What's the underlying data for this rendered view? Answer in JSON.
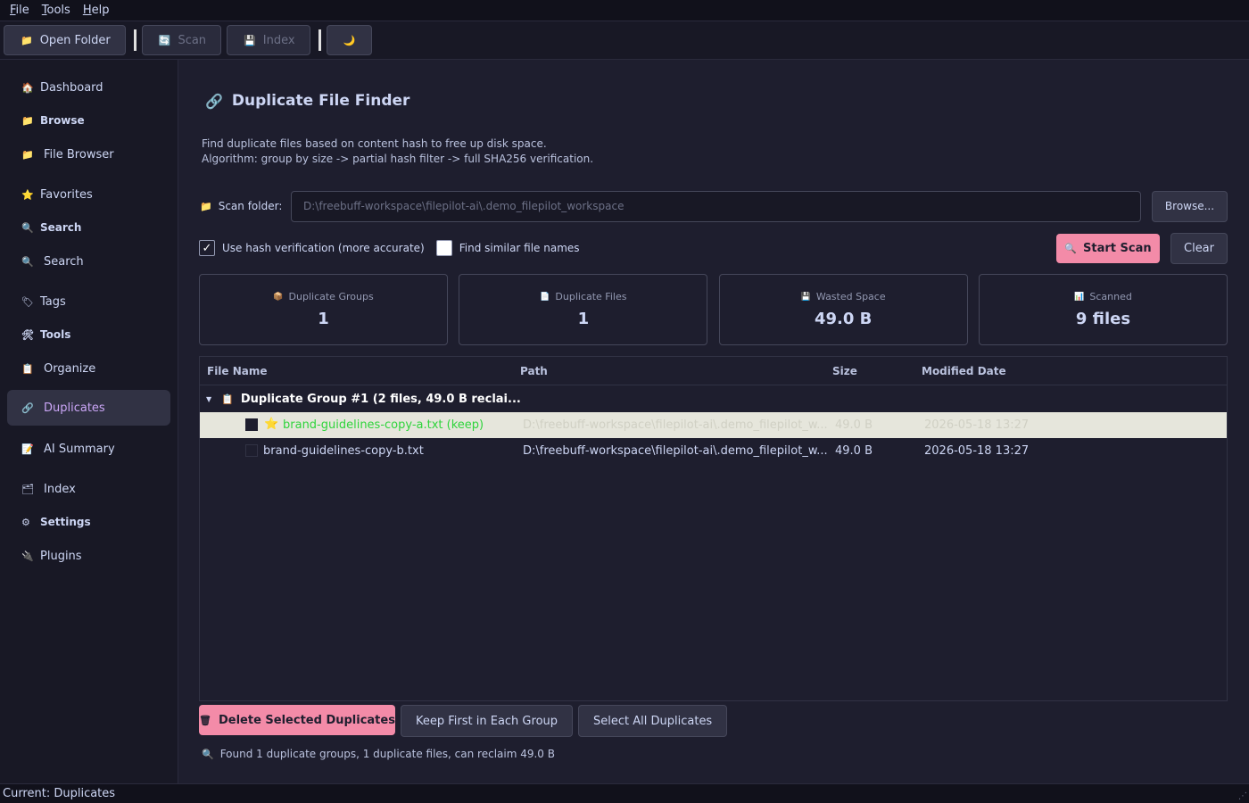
{
  "menu": [
    {
      "label": "File",
      "key": "F",
      "rest": "ile"
    },
    {
      "label": "Tools",
      "key": "T",
      "rest": "ools"
    },
    {
      "label": "Help",
      "key": "H",
      "rest": "elp"
    }
  ],
  "toolbar": {
    "open_folder": "Open Folder",
    "scan": "Scan",
    "index": "Index",
    "theme_icon": "🌙"
  },
  "sidebar": {
    "dashboard": "Dashboard",
    "browse_section": "Browse",
    "file_browser": "File Browser",
    "favorites": "Favorites",
    "search_section": "Search",
    "search": "Search",
    "tags": "Tags",
    "tools_section": "Tools",
    "organize": "Organize",
    "duplicates": "Duplicates",
    "ai_summary": "AI Summary",
    "index": "Index",
    "settings_section": "Settings",
    "plugins": "Plugins"
  },
  "page": {
    "title": "Duplicate File Finder",
    "desc_line1": "Find duplicate files based on content hash to free up disk space.",
    "desc_line2": "Algorithm: group by size -> partial hash filter -> full SHA256 verification.",
    "scan_label": "Scan folder:",
    "scan_path": "D:\\freebuff-workspace\\filepilot-ai\\.demo_filepilot_workspace",
    "browse": "Browse...",
    "opt_hash": "Use hash verification (more accurate)",
    "opt_similar": "Find similar file names",
    "start_scan": "Start Scan",
    "clear": "Clear"
  },
  "stats": [
    {
      "label": "Duplicate Groups",
      "value": "1",
      "icon": "📦"
    },
    {
      "label": "Duplicate Files",
      "value": "1",
      "icon": "📄"
    },
    {
      "label": "Wasted Space",
      "value": "49.0 B",
      "icon": "💾"
    },
    {
      "label": "Scanned",
      "value": "9 files",
      "icon": "📊"
    }
  ],
  "table": {
    "headers": {
      "name": "File Name",
      "path": "Path",
      "size": "Size",
      "modified": "Modified Date"
    },
    "group_label": "Duplicate Group #1  (2 files, 49.0 B reclai...",
    "rows": [
      {
        "name": "brand-guidelines-copy-a.txt (keep)",
        "path": "D:\\freebuff-workspace\\filepilot-ai\\.demo_filepilot_w...",
        "size": "49.0 B",
        "modified": "2026-05-18 13:27"
      },
      {
        "name": "brand-guidelines-copy-b.txt",
        "path": "D:\\freebuff-workspace\\filepilot-ai\\.demo_filepilot_w...",
        "size": "49.0 B",
        "modified": "2026-05-18 13:27"
      }
    ]
  },
  "actions": {
    "delete": "Delete Selected Duplicates",
    "keep_first": "Keep First in Each Group",
    "select_all": "Select All Duplicates"
  },
  "result_text": "Found 1 duplicate groups, 1 duplicate files, can reclaim 49.0 B",
  "statusbar": "Current: Duplicates",
  "colors": {
    "accent": "#f38ba8",
    "active_nav": "#cba6f7",
    "keep_file": "#2fd43c"
  }
}
